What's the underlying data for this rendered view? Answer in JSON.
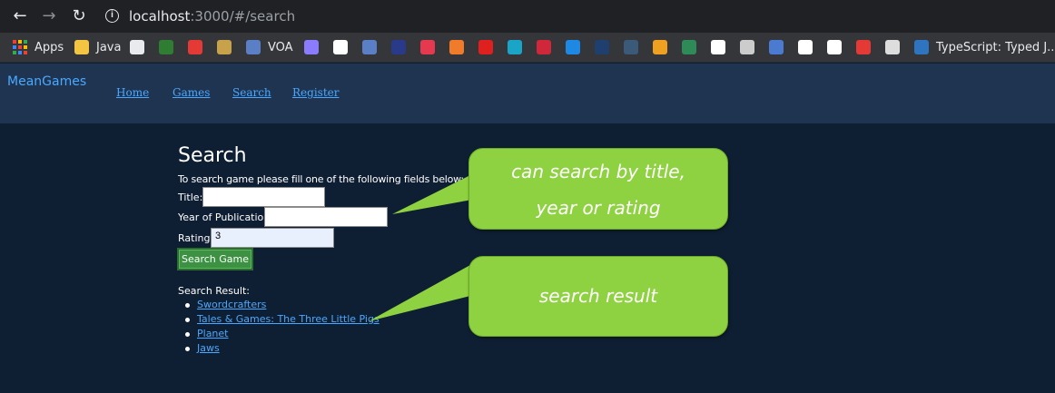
{
  "browser": {
    "url_host": "localhost",
    "url_rest": ":3000/#/search",
    "bookmarks": [
      {
        "label": "Apps",
        "icon": "apps-grid-icon"
      },
      {
        "label": "Java",
        "icon": "folder-icon",
        "color": "#f4c542"
      },
      {
        "label": "",
        "icon": "github-icon",
        "color": "#e8eaed"
      },
      {
        "label": "",
        "icon": "w-icon",
        "color": "#2e7d32"
      },
      {
        "label": "",
        "icon": "o-icon",
        "color": "#e53935"
      },
      {
        "label": "",
        "icon": "box-icon",
        "color": "#c8a24a"
      },
      {
        "label": "VOA",
        "icon": "voa-icon",
        "color": "#5b7fc6"
      },
      {
        "label": "",
        "icon": "code-icon",
        "color": "#8a7bff"
      },
      {
        "label": "",
        "icon": "bird-icon",
        "color": "#ffffff"
      },
      {
        "label": "",
        "icon": "voa-icon",
        "color": "#5b7fc6"
      },
      {
        "label": "",
        "icon": "x-icon",
        "color": "#2a3a8a"
      },
      {
        "label": "",
        "icon": "n-icon",
        "color": "#e53950"
      },
      {
        "label": "",
        "icon": "cube-icon",
        "color": "#f07b2a"
      },
      {
        "label": "",
        "icon": "oracle-icon",
        "color": "#e01f1f"
      },
      {
        "label": "",
        "icon": "ev-icon",
        "color": "#1aa5c8"
      },
      {
        "label": "",
        "icon": "swirl-icon",
        "color": "#d0283a"
      },
      {
        "label": "",
        "icon": "azure-icon",
        "color": "#1e88e5"
      },
      {
        "label": "",
        "icon": "tr-icon",
        "color": "#1f3f6e"
      },
      {
        "label": "",
        "icon": "tds-icon",
        "color": "#3b5a7a"
      },
      {
        "label": "",
        "icon": "music-icon",
        "color": "#f0a020"
      },
      {
        "label": "",
        "icon": "gfg-icon",
        "color": "#2e8b57"
      },
      {
        "label": "",
        "icon": "codepen-icon",
        "color": "#ffffff"
      },
      {
        "label": "",
        "icon": "pattern-icon",
        "color": "#cccccc"
      },
      {
        "label": "",
        "icon": "r-icon",
        "color": "#4b7bd1"
      },
      {
        "label": "",
        "icon": "circle-icon",
        "color": "#ffffff"
      },
      {
        "label": "",
        "icon": "codepen-icon",
        "color": "#ffffff"
      },
      {
        "label": "",
        "icon": "figure-icon",
        "color": "#e53935"
      },
      {
        "label": "",
        "icon": "screen-icon",
        "color": "#dddddd"
      },
      {
        "label": "TypeScript: Typed J...",
        "icon": "ts-icon",
        "color": "#2f74c0"
      }
    ]
  },
  "app": {
    "brand": "MeanGames",
    "nav": [
      "Home",
      "Games",
      "Search",
      "Register"
    ],
    "title": "Search",
    "instructions": "To search game please fill one of the following fields below:",
    "fields": {
      "title_label": "Title:",
      "title_value": "",
      "year_label": "Year of Publication:",
      "year_value": "",
      "rating_label": "Rating:",
      "rating_value": "3"
    },
    "search_button": "Search Game",
    "result_label": "Search Result:",
    "results": [
      "Swordcrafters",
      "Tales & Games: The Three Little Pigs",
      "Planet",
      "Jaws"
    ]
  },
  "callouts": {
    "search_hint_line1": "can search by title,",
    "search_hint_line2": "year or rating",
    "result_hint": "search result",
    "color": "#8fd241"
  }
}
